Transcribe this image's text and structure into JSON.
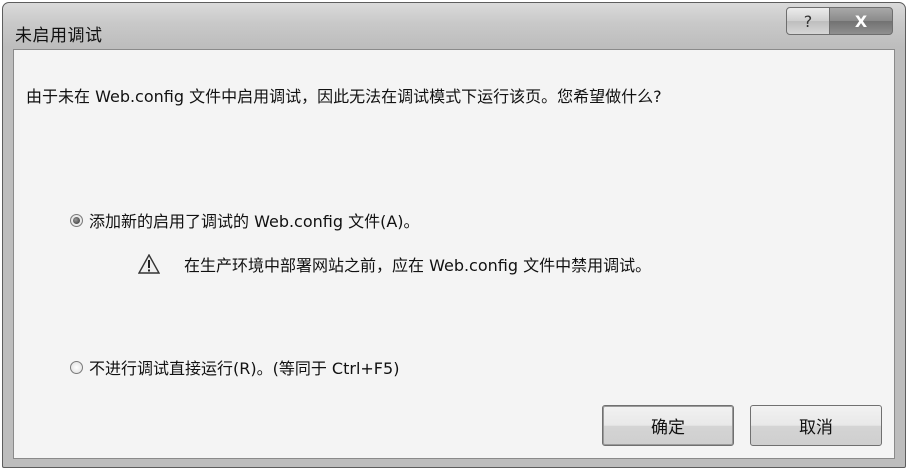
{
  "window": {
    "title": "未启用调试",
    "help_label": "?",
    "close_label": "X"
  },
  "message": "由于未在 Web.config 文件中启用调试，因此无法在调试模式下运行该页。您希望做什么?",
  "options": [
    {
      "label": "添加新的启用了调试的 Web.config 文件(A)。",
      "selected": true
    },
    {
      "label": "不进行调试直接运行(R)。(等同于 Ctrl+F5)",
      "selected": false
    }
  ],
  "warning": {
    "icon": "warning-icon",
    "text": "在生产环境中部署网站之前，应在 Web.config 文件中禁用调试。"
  },
  "buttons": {
    "ok_label": "确定",
    "cancel_label": "取消"
  }
}
